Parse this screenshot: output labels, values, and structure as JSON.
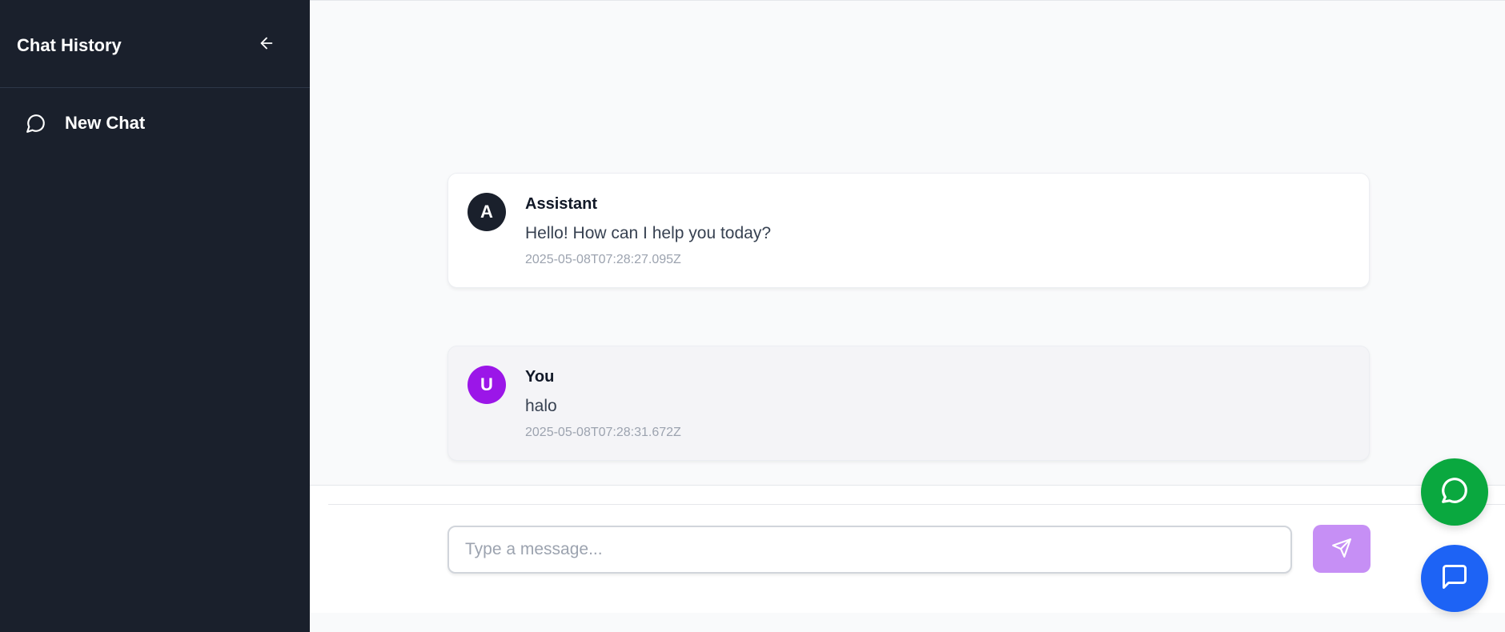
{
  "sidebar": {
    "title": "Chat History",
    "collapse_icon": "arrow-left-icon",
    "new_chat": {
      "label": "New Chat",
      "icon": "message-circle-icon"
    }
  },
  "messages": [
    {
      "role": "assistant",
      "avatar": "A",
      "sender": "Assistant",
      "text": "Hello! How can I help you today?",
      "timestamp": "2025-05-08T07:28:27.095Z"
    },
    {
      "role": "user",
      "avatar": "U",
      "sender": "You",
      "text": "halo",
      "timestamp": "2025-05-08T07:28:31.672Z"
    }
  ],
  "composer": {
    "placeholder": "Type a message...",
    "value": "",
    "send_icon": "send-icon"
  },
  "floating": {
    "whatsapp_icon": "whatsapp-icon",
    "chat_icon": "message-square-icon"
  },
  "colors": {
    "sidebar_bg": "#1a202c",
    "assistant_avatar": "#1a202c",
    "user_avatar": "#9b16e8",
    "send_button": "#c68ff5",
    "whatsapp_fab": "#0aa83f",
    "chat_fab": "#1d63f5"
  }
}
